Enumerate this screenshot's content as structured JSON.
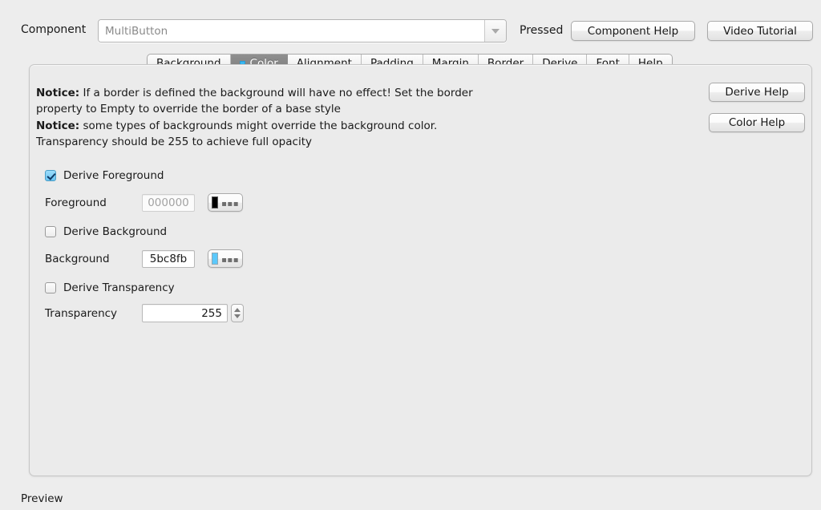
{
  "header": {
    "component_label": "Component",
    "component_value": "MultiButton",
    "component_placeholder": "MultiButton",
    "dropdown_icon": "chevron-down-icon",
    "state_label": "Pressed",
    "component_help_label": "Component Help",
    "video_tutorial_label": "Video Tutorial"
  },
  "tabs": [
    {
      "label": "Background",
      "selected": false,
      "icon": ""
    },
    {
      "label": "Color",
      "selected": true,
      "icon": "color-square-icon"
    },
    {
      "label": "Alignment",
      "selected": false,
      "icon": ""
    },
    {
      "label": "Padding",
      "selected": false,
      "icon": ""
    },
    {
      "label": "Margin",
      "selected": false,
      "icon": ""
    },
    {
      "label": "Border",
      "selected": false,
      "icon": ""
    },
    {
      "label": "Derive",
      "selected": false,
      "icon": ""
    },
    {
      "label": "Font",
      "selected": false,
      "icon": ""
    },
    {
      "label": "Help",
      "selected": false,
      "icon": ""
    }
  ],
  "panel": {
    "notices": [
      {
        "prefix": "Notice:",
        "text": " If a border is defined the background will have no effect! Set the border property to Empty to override the border of a base style"
      },
      {
        "prefix": "Notice:",
        "text": " some types of backgrounds might override the background color. Transparency should be 255 to achieve full opacity"
      }
    ],
    "derive_help_label": "Derive Help",
    "color_help_label": "Color Help",
    "derive_foreground_label": "Derive Foreground",
    "derive_foreground_checked": true,
    "foreground_label": "Foreground",
    "foreground_value": "000000",
    "foreground_swatch_color": "#000000",
    "derive_background_label": "Derive Background",
    "derive_background_checked": false,
    "background_label": "Background",
    "background_value": "5bc8fb",
    "background_swatch_color": "#5bc8fb",
    "derive_transparency_label": "Derive Transparency",
    "derive_transparency_checked": false,
    "transparency_label": "Transparency",
    "transparency_value": "255",
    "swatch_more_dots": "▪▪▪"
  },
  "footer": {
    "preview_label": "Preview"
  },
  "colors": {
    "window_background": "#ededed",
    "panel_background": "#ebebeb",
    "accent_blue": "#5bc8fb",
    "tab_selected_background": "#858585",
    "text": "#1a1a1a"
  }
}
